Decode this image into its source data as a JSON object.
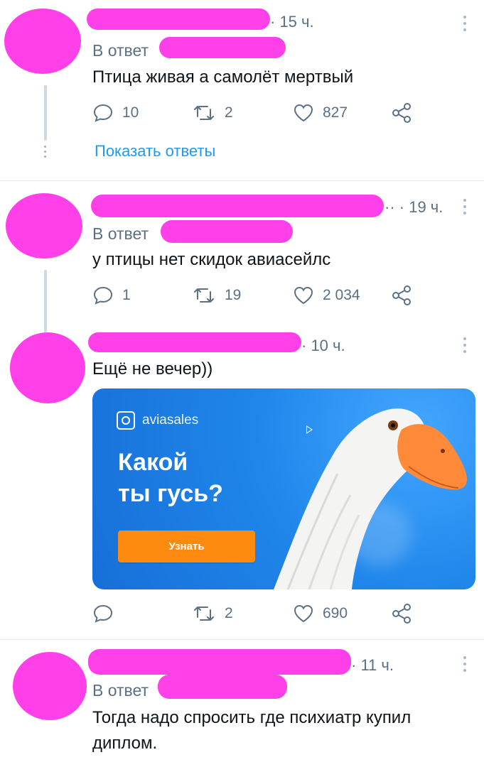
{
  "tweets": [
    {
      "time": "· 15 ч.",
      "reply_prefix": "В ответ",
      "text": "Птица живая а самолёт мертвый",
      "replies": "10",
      "retweets": "2",
      "likes": "827",
      "show_replies": "Показать ответы"
    },
    {
      "time": "·· · 19 ч.",
      "reply_prefix": "В ответ",
      "text": "у птицы нет скидок авиасейлс",
      "replies": "1",
      "retweets": "19",
      "likes": "2 034"
    },
    {
      "time": "· 10 ч.",
      "text": "Ещё не вечер))",
      "replies": "",
      "retweets": "2",
      "likes": "690",
      "ad": {
        "brand": "aviasales",
        "headline_line1": "Какой",
        "headline_line2": "ты гусь?",
        "cta": "Узнать"
      }
    },
    {
      "time": "· 11 ч.",
      "reply_prefix": "В ответ",
      "text_line1": "Тогда надо спросить где психиатр купил",
      "text_line2": "диплом."
    }
  ],
  "colors": {
    "redaction": "#ff40e8",
    "link": "#1d9bf0",
    "secondary_text": "#5b7083",
    "ad_button": "#ff8a10",
    "ad_background": "#1f86ea"
  }
}
